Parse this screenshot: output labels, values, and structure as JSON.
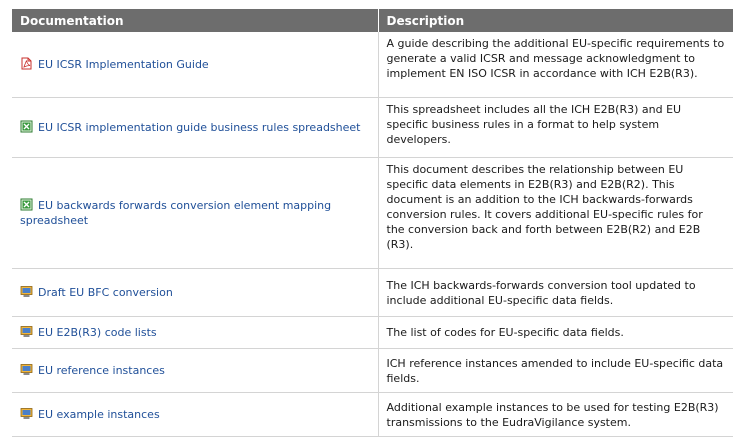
{
  "header": {
    "documentation": "Documentation",
    "description": "Description"
  },
  "rows": [
    {
      "icon": "pdf-icon",
      "title": "EU ICSR Implementation Guide",
      "desc": [
        "A guide describing the additional EU-specific requirements to",
        "generate a valid ICSR and message acknowledgment to",
        "implement EN ISO ICSR in accordance with ICH E2B(R3)."
      ]
    },
    {
      "icon": "excel-icon",
      "title": "EU ICSR implementation guide business rules spreadsheet",
      "desc": [
        "This spreadsheet includes all the ICH E2B(R3) and EU",
        "specific business rules in a format to help system",
        "developers."
      ]
    },
    {
      "icon": "excel-icon",
      "title": "EU backwards forwards conversion element mapping spreadsheet",
      "desc": [
        "This document describes the relationship between EU",
        "specific data elements in E2B(R3) and E2B(R2). This",
        "document is an addition to the ICH backwards-forwards",
        "conversion rules. It covers additional EU-specific rules for",
        "the conversion back and forth between E2B(R2) and E2B",
        "(R3)."
      ]
    },
    {
      "icon": "computer-icon",
      "title": "Draft EU BFC conversion",
      "desc": [
        "The ICH backwards-forwards conversion tool updated to",
        "include additional EU-specific data fields."
      ]
    },
    {
      "icon": "computer-icon",
      "title": "EU E2B(R3) code lists",
      "desc": [
        "The list of codes for EU-specific data fields."
      ]
    },
    {
      "icon": "computer-icon",
      "title": "EU reference instances",
      "desc": [
        "ICH reference instances amended to include EU-specific data",
        "fields."
      ]
    },
    {
      "icon": "computer-icon",
      "title": "EU example instances",
      "desc": [
        "Additional example instances to be used for testing E2B(R3)",
        "transmissions to the EudraVigilance system."
      ]
    }
  ]
}
